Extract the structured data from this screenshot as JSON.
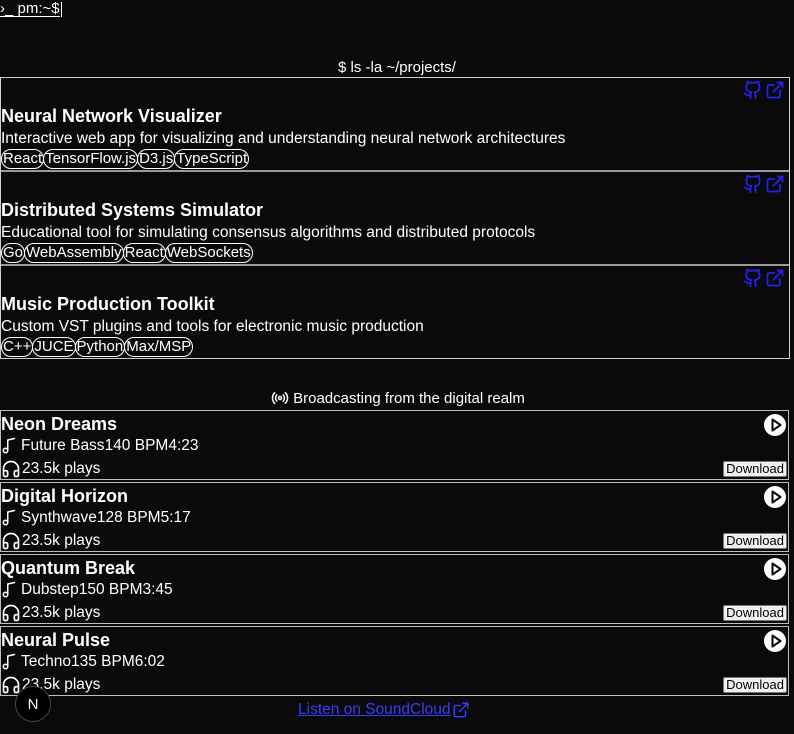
{
  "header": {
    "prompt": "›_ pm:~$"
  },
  "projects_section": {
    "command": "$ ls -la ~/projects/"
  },
  "projects": [
    {
      "title": "Neural Network Visualizer",
      "description": "Interactive web app for visualizing and understanding neural network architectures",
      "tags": [
        "React",
        "TensorFlow.js",
        "D3.js",
        "TypeScript"
      ],
      "icons": [
        "github-icon",
        "external-link-icon"
      ]
    },
    {
      "title": "Distributed Systems Simulator",
      "description": "Educational tool for simulating consensus algorithms and distributed protocols",
      "tags": [
        "Go",
        "WebAssembly",
        "React",
        "WebSockets"
      ],
      "icons": [
        "github-icon",
        "external-link-icon"
      ]
    },
    {
      "title": "Music Production Toolkit",
      "description": "Custom VST plugins and tools for electronic music production",
      "tags": [
        "C++",
        "JUCE",
        "Python",
        "Max/MSP"
      ],
      "icons": [
        "github-icon",
        "external-link-icon"
      ]
    }
  ],
  "music_section": {
    "heading": "Broadcasting from the digital realm",
    "icon": "radio-broadcast-icon"
  },
  "tracks": [
    {
      "title": "Neon Dreams",
      "genre": "Future Bass",
      "bpm": "140 BPM",
      "duration": "4:23",
      "plays": "23.5k plays",
      "download_label": "Download"
    },
    {
      "title": "Digital Horizon",
      "genre": "Synthwave",
      "bpm": "128 BPM",
      "duration": "5:17",
      "plays": "23.5k plays",
      "download_label": "Download"
    },
    {
      "title": "Quantum Break",
      "genre": "Dubstep",
      "bpm": "150 BPM",
      "duration": "3:45",
      "plays": "23.5k plays",
      "download_label": "Download"
    },
    {
      "title": "Neural Pulse",
      "genre": "Techno",
      "bpm": "135 BPM",
      "duration": "6:02",
      "plays": "23.5k plays",
      "download_label": "Download"
    }
  ],
  "footer": {
    "soundcloud_label": "Listen on SoundCloud"
  },
  "dev_badge": {
    "label": "N"
  },
  "colors": {
    "background": "#0a0a0a",
    "text": "#ffffff",
    "link": "#3b3bff",
    "icon_accent": "#2222ff"
  }
}
